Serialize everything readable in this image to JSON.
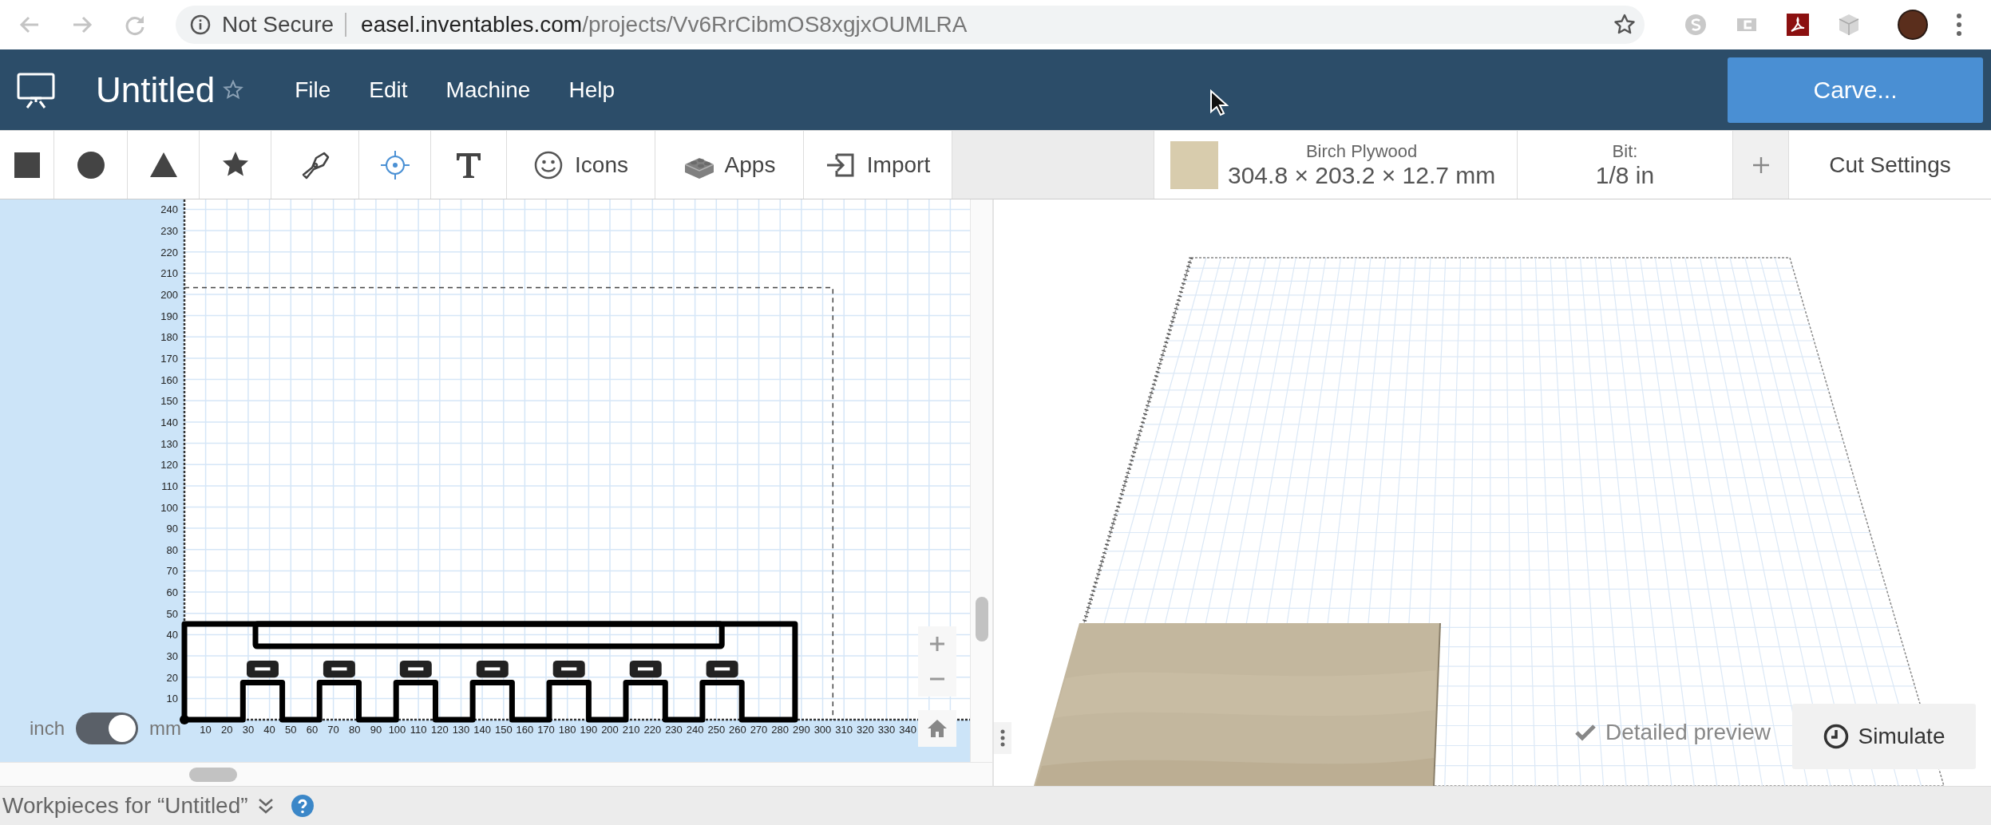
{
  "browser": {
    "security": "Not Secure",
    "host": "easel.inventables.com",
    "path": "/projects/Vv6RrCibmOS8xgjxOUMLRA"
  },
  "app_bar": {
    "title": "Untitled",
    "starred": false,
    "menus": [
      "File",
      "Edit",
      "Machine",
      "Help"
    ],
    "carve_button": "Carve..."
  },
  "toolbar": {
    "tools": [
      {
        "selected": false
      },
      {
        "selected": false
      },
      {
        "selected": false
      },
      {
        "selected": false
      },
      {
        "selected": false
      },
      {
        "selected": true
      },
      {
        "selected": false
      },
      {
        "label": "Icons",
        "selected": false
      },
      {
        "label": "Apps",
        "selected": false
      },
      {
        "label": "Import",
        "selected": false
      }
    ],
    "material": {
      "name": "Birch Plywood",
      "dimensions": "304.8 × 203.2 × 12.7 mm"
    },
    "bit": {
      "label": "Bit:",
      "value": "1/8 in"
    },
    "cut_settings": "Cut Settings"
  },
  "canvas": {
    "y_ruler": [
      "240",
      "230",
      "220",
      "210",
      "200",
      "190",
      "180",
      "170",
      "160",
      "150",
      "140",
      "130",
      "120",
      "110",
      "100",
      "90",
      "80",
      "70",
      "60",
      "50",
      "40",
      "30",
      "20",
      "10"
    ],
    "x_ruler": [
      "10",
      "20",
      "30",
      "40",
      "50",
      "60",
      "70",
      "80",
      "90",
      "100",
      "110",
      "120",
      "130",
      "140",
      "150",
      "160",
      "170",
      "180",
      "190",
      "200",
      "210",
      "220",
      "230",
      "240",
      "250",
      "260",
      "270",
      "280",
      "290",
      "300",
      "310",
      "320",
      "330",
      "340"
    ],
    "unit_toggle": {
      "left_label": "inch",
      "right_label": "mm",
      "on": true
    }
  },
  "preview": {
    "detailed_preview": {
      "label": "Detailed preview",
      "checked": true
    },
    "simulate_button": "Simulate"
  },
  "footer": {
    "title": "Workpieces for “Untitled”"
  }
}
